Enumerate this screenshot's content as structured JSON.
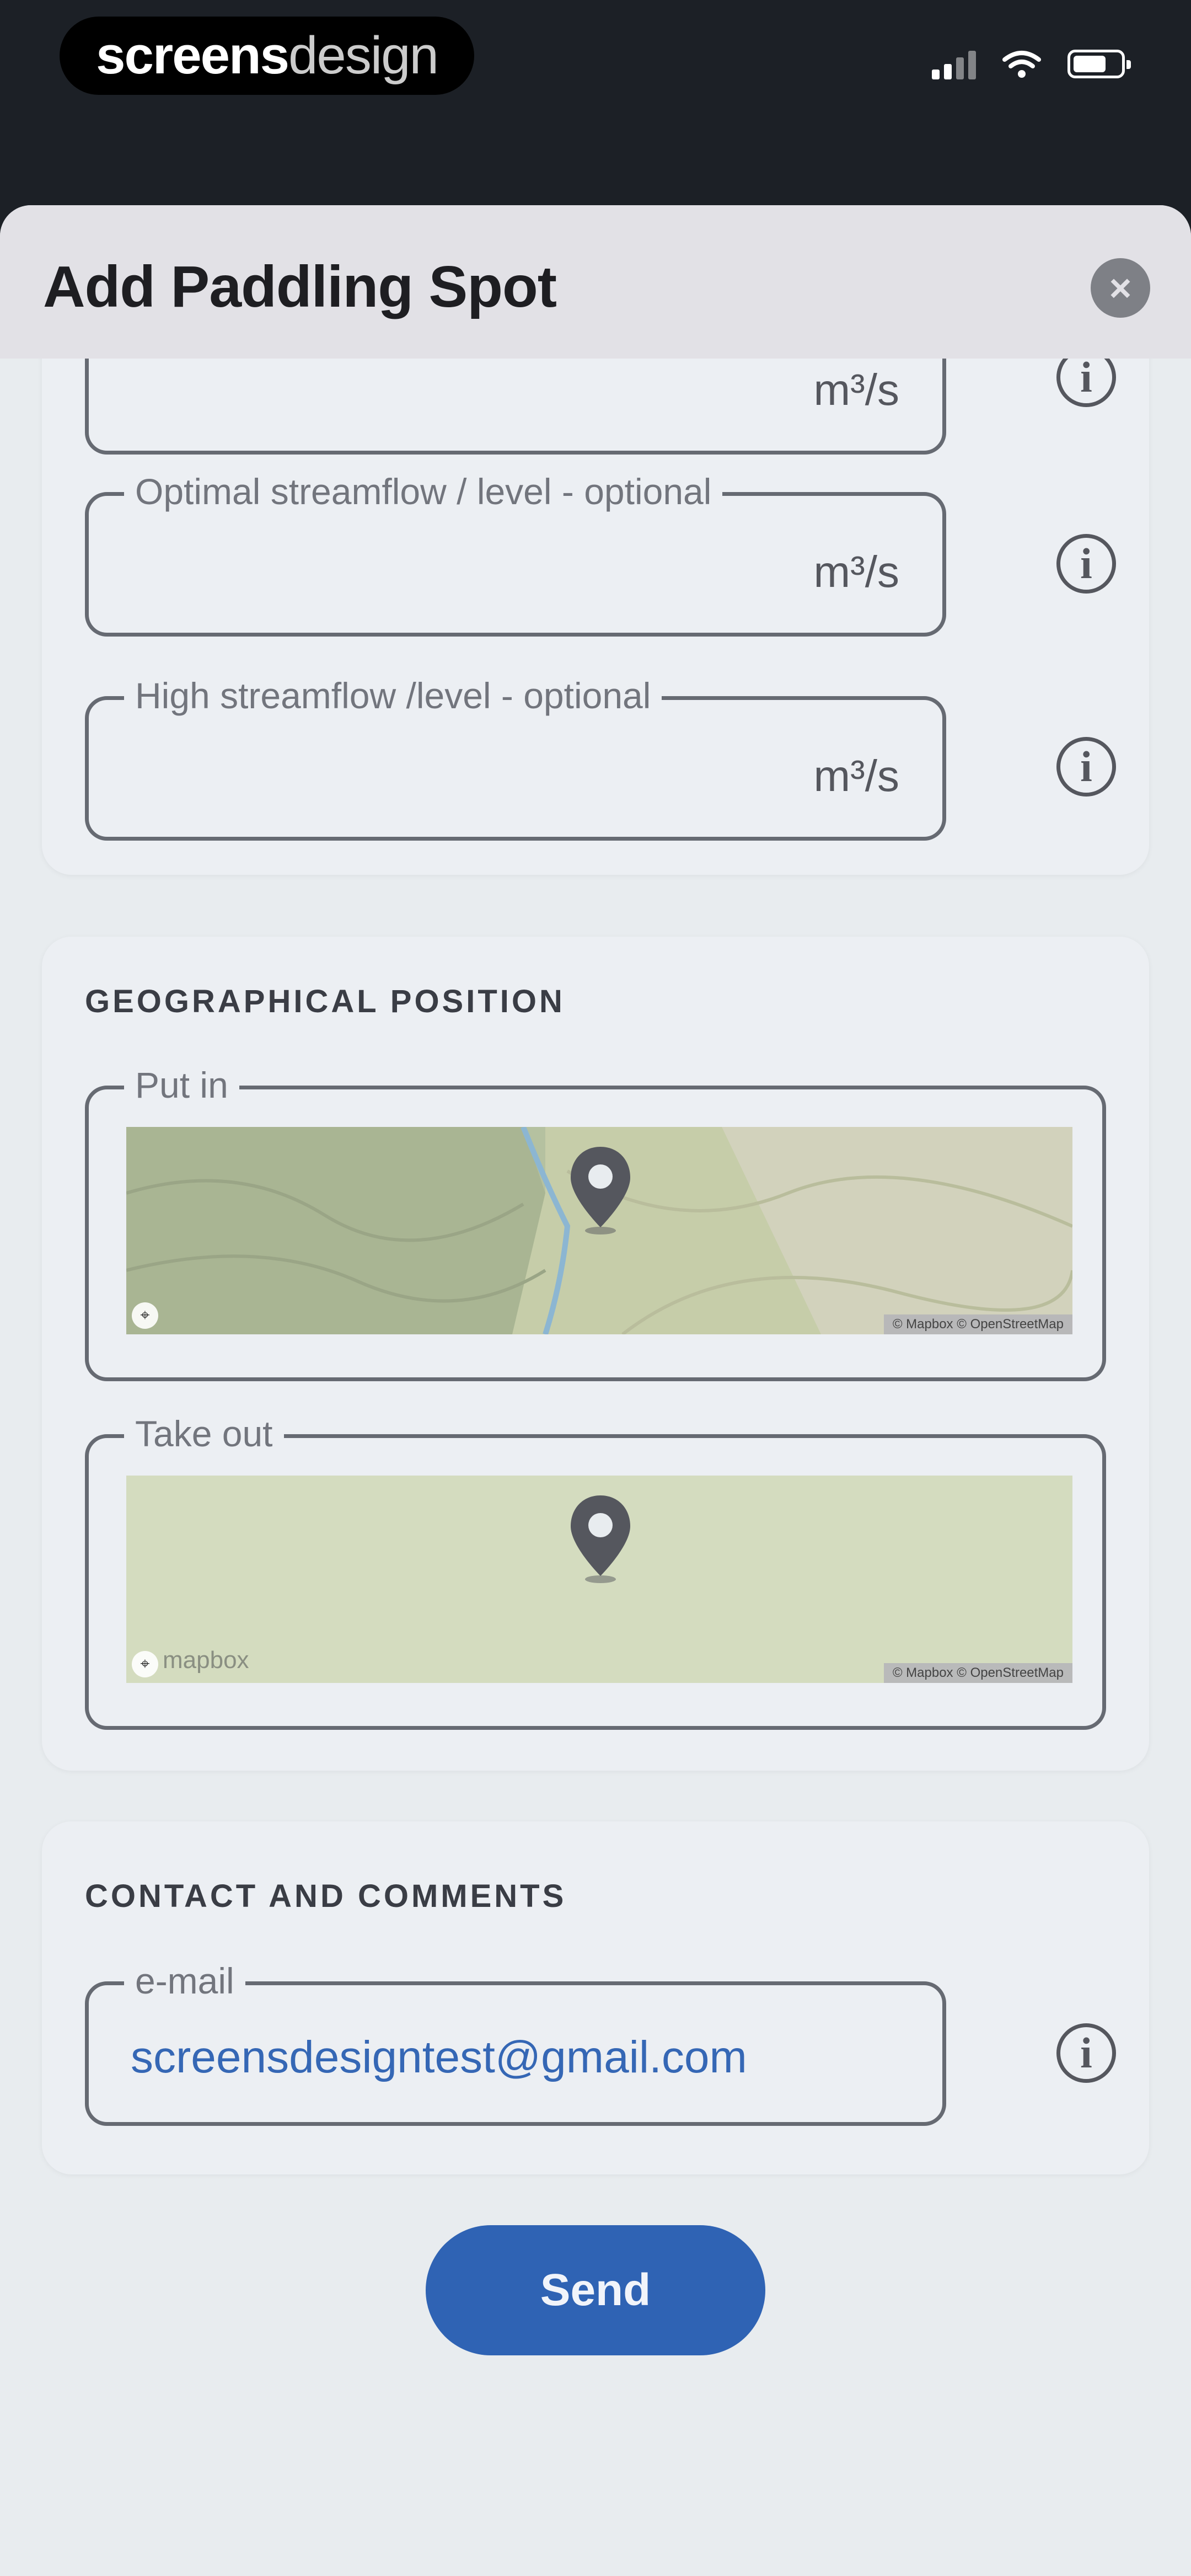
{
  "status_bar": {
    "brand_bold": "screens",
    "brand_light": "design",
    "signal_icon": "cellular-signal-icon",
    "wifi_icon": "wifi-icon",
    "battery_icon": "battery-icon",
    "battery_level": 0.62
  },
  "sheet": {
    "title": "Add Paddling Spot",
    "close_icon": "close-icon",
    "close_glyph": "×"
  },
  "streamflow": {
    "fields": [
      {
        "label": "",
        "unit": "m³/s"
      },
      {
        "label": "Optimal streamflow / level - optional",
        "unit": "m³/s"
      },
      {
        "label": "High streamflow /level - optional",
        "unit": "m³/s"
      }
    ],
    "info_glyph": "i"
  },
  "geo": {
    "title": "GEOGRAPHICAL POSITION",
    "put_in_label": "Put in",
    "take_out_label": "Take out",
    "pin_icon": "map-pin-icon",
    "map_logo_text": "mapbox",
    "map_credit": "© Mapbox © OpenStreetMap",
    "map_colors": {
      "topo_base": "#b5c1a0",
      "plain": "#d4dcbf",
      "river": "#8cb6d2"
    }
  },
  "contact": {
    "title": "CONTACT AND COMMENTS",
    "email_label": "e-mail",
    "email_value": "screensdesigntest@gmail.com"
  },
  "actions": {
    "send_label": "Send"
  },
  "colors": {
    "accent": "#2f63b4",
    "sheet_bg": "#e8ecef",
    "header_bg": "#e2e1e6",
    "status_bg": "#1c2026"
  }
}
